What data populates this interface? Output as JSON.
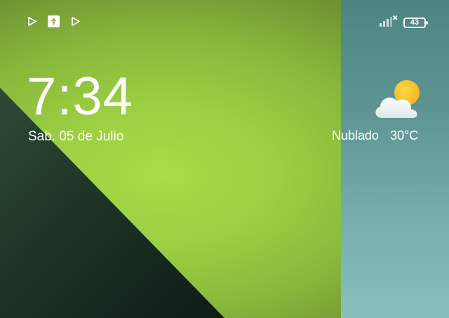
{
  "status_bar": {
    "left_icons": [
      "play-store-icon",
      "upload-icon",
      "play-store-icon"
    ],
    "signal_icon": "signal-no-connection-icon",
    "battery_level": "43"
  },
  "lock_screen": {
    "time": "7:34",
    "date": "Sab. 05 de Julio"
  },
  "weather": {
    "icon": "partly-cloudy-icon",
    "condition": "Nublado",
    "temperature": "30°C"
  },
  "colors": {
    "wallpaper_green": "#9ccf42",
    "wallpaper_dark": "#1a2f22",
    "panel_teal": "#5e9594",
    "text": "#ffffff"
  }
}
